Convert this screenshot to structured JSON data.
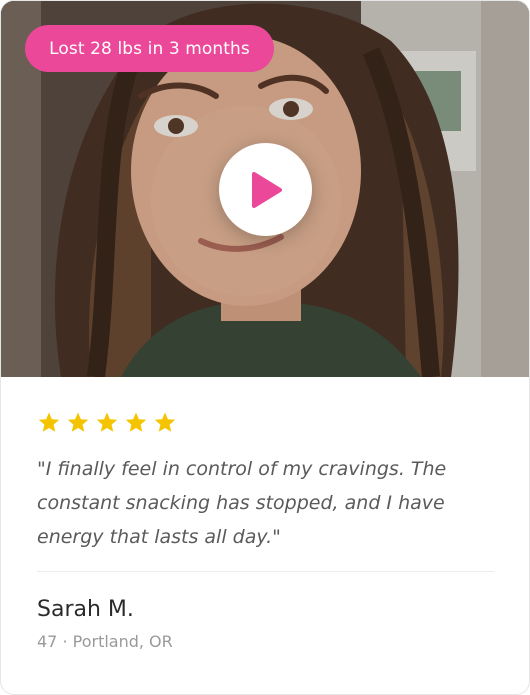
{
  "video": {
    "badge_text": "Lost 28 lbs in 3 months",
    "play_icon": "play-icon"
  },
  "review": {
    "rating": 5,
    "rating_max": 5,
    "quote": "\"I finally feel in control of my cravings. The constant snacking has stopped, and I have energy that lasts all day.\"",
    "author_name": "Sarah M.",
    "author_meta": "47 · Portland, OR"
  },
  "colors": {
    "accent": "#ec4899",
    "star": "#f5c400",
    "quote_text": "#5a5a5a",
    "meta_text": "#9a9a9a"
  }
}
